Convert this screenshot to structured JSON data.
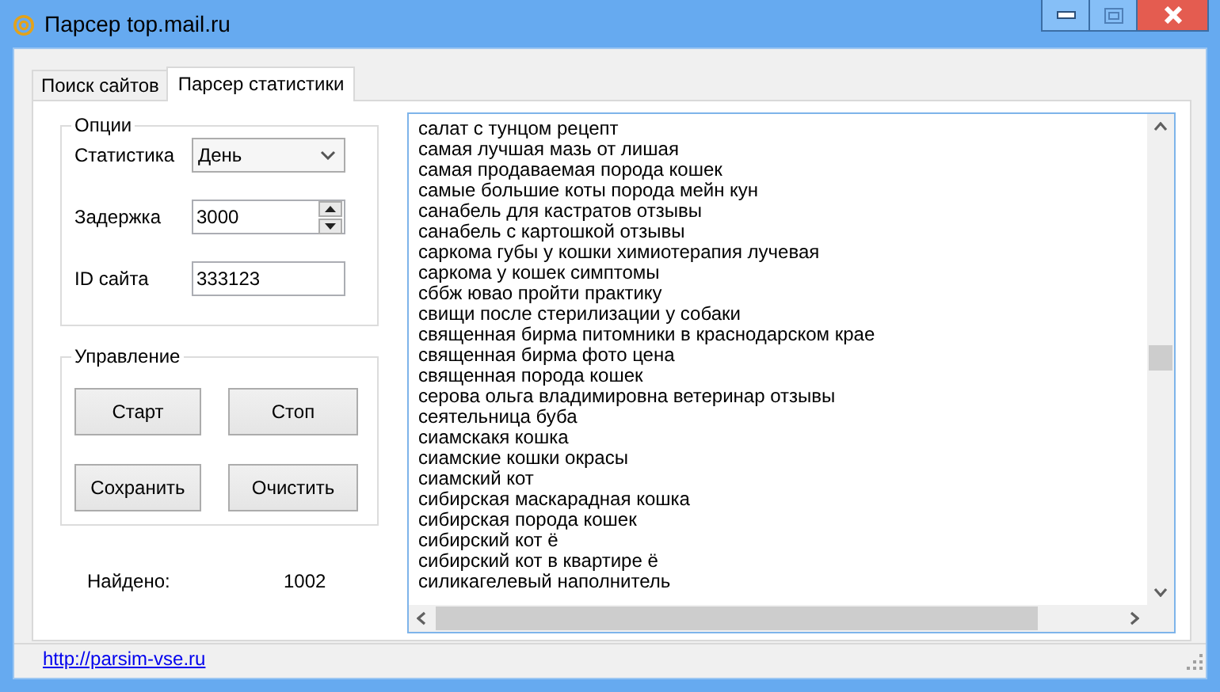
{
  "window": {
    "title": "Парсер top.mail.ru"
  },
  "tabs": [
    {
      "label": "Поиск сайтов",
      "selected": false
    },
    {
      "label": "Парсер статистики",
      "selected": true
    }
  ],
  "options": {
    "title": "Опции",
    "fields": [
      {
        "kind": "combo",
        "label": "Статистика",
        "value": "День"
      },
      {
        "kind": "spin",
        "label": "Задержка",
        "value": "3000"
      },
      {
        "kind": "text",
        "label": "ID сайта",
        "value": "333123"
      }
    ]
  },
  "control": {
    "title": "Управление",
    "buttons": [
      "Старт",
      "Стоп",
      "Сохранить",
      "Очистить"
    ]
  },
  "found": {
    "label": "Найдено:",
    "value": "1002"
  },
  "results": [
    "салат с тунцом рецепт",
    "самая лучшая мазь от лишая",
    "самая продаваемая порода кошек",
    "самые большие коты порода мейн кун",
    "санабель для кастратов отзывы",
    "санабель с картошкой отзывы",
    "саркома губы у кошки химиотерапия лучевая",
    "саркома у кошек симптомы",
    "сббж ювао пройти практику",
    "свищи после стерилизации у собаки",
    "священная бирма питомники в краснодарском крае",
    "священная бирма фото цена",
    "священная порода кошек",
    "серова ольга владимировна ветеринар отзывы",
    "сеятельница буба",
    "сиамскакя кошка",
    "сиамские кошки окрасы",
    "сиамский кот",
    "сибирская маскарадная кошка",
    "сибирская порода кошек",
    "сибирский кот ё",
    "сибирский кот в квартире ё",
    "силикагелевый наполнитель"
  ],
  "status_bar": {
    "link": "http://parsim-vse.ru"
  }
}
